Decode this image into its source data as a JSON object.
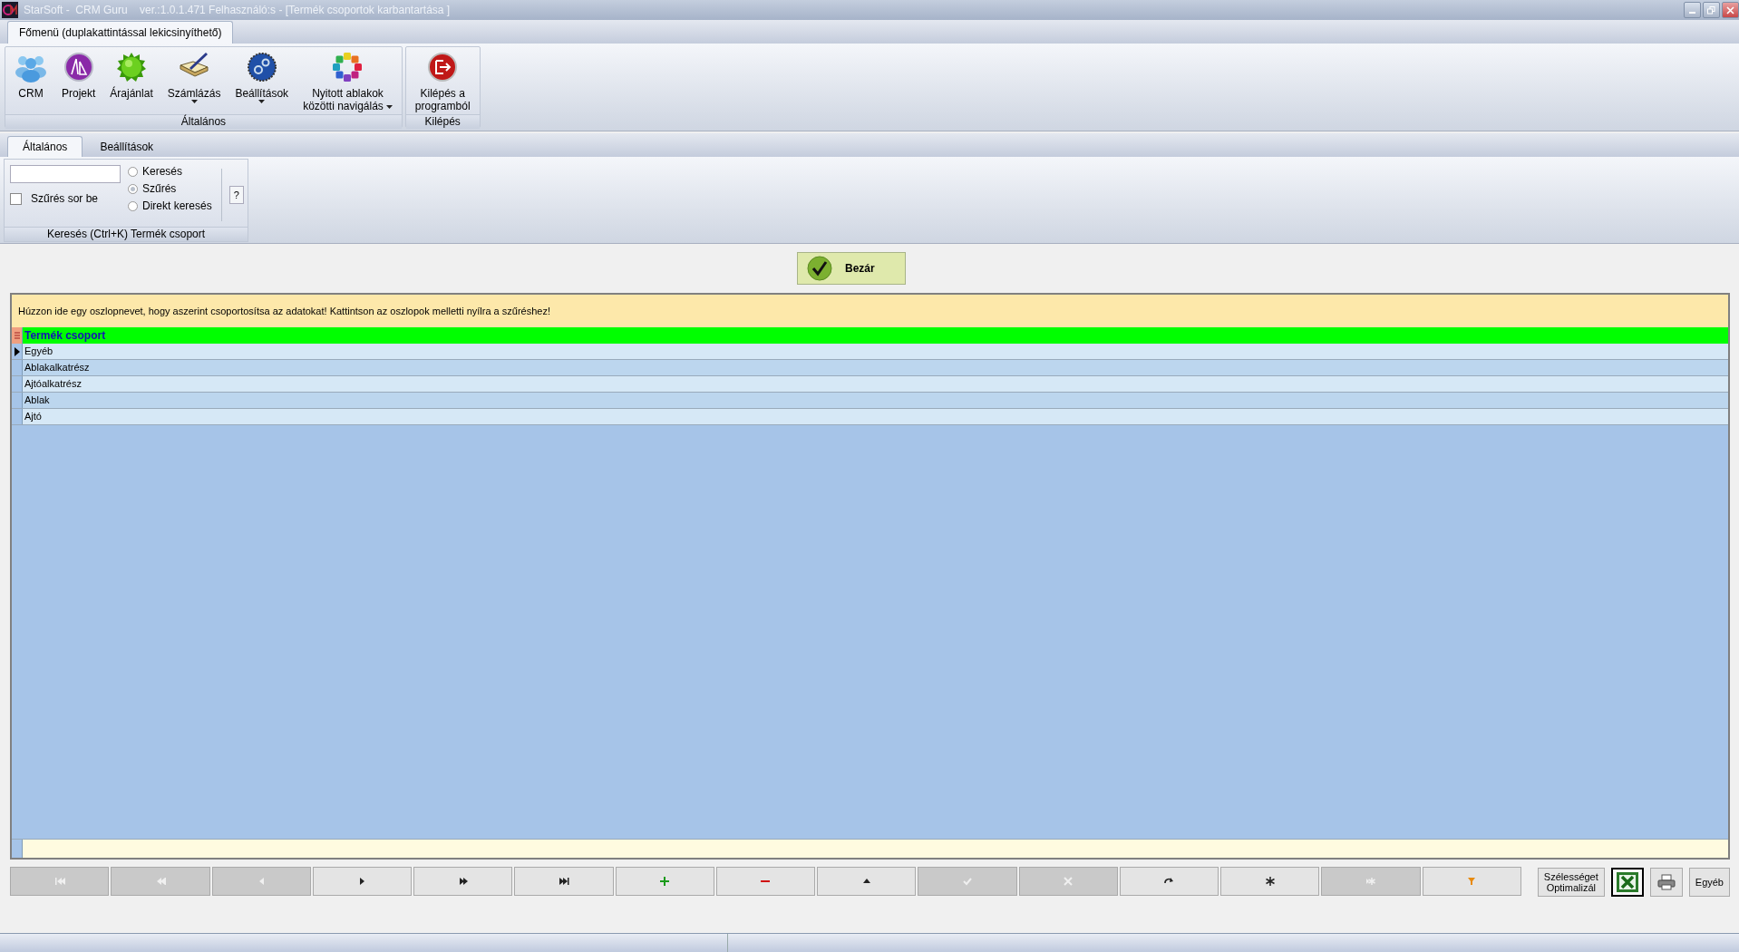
{
  "window": {
    "title": "StarSoft -  CRM Guru    ver.:1.0.1.471 Felhasználó:s - [Termék csoportok karbantartása ]"
  },
  "ribbon": {
    "tabs": [
      {
        "label": "Főmenü (duplakattintással lekicsinyíthető)",
        "selected": true
      }
    ],
    "groups": [
      {
        "label": "Általános",
        "items": [
          {
            "kind": "people",
            "label": "CRM",
            "dropdown": false
          },
          {
            "kind": "compass",
            "label": "Projekt",
            "dropdown": false
          },
          {
            "kind": "starburst",
            "label": "Árajánlat",
            "dropdown": false
          },
          {
            "kind": "book",
            "label": "Számlázás",
            "dropdown": true
          },
          {
            "kind": "gears",
            "label": "Beállítások",
            "dropdown": true
          },
          {
            "kind": "ring",
            "label": "Nyitott ablakok\nközötti navigálás",
            "dropdown": true
          }
        ]
      },
      {
        "label": "Kilépés",
        "items": [
          {
            "kind": "exit",
            "label": "Kilépés a\nprogramból",
            "dropdown": false
          }
        ]
      }
    ]
  },
  "tabs": [
    {
      "label": "Általános",
      "selected": true
    },
    {
      "label": "Beállítások",
      "selected": false
    }
  ],
  "search": {
    "filter_row": {
      "label": "Szűrés sor be",
      "checked": false
    },
    "modes": [
      {
        "label": "Keresés",
        "selected": false
      },
      {
        "label": "Szűrés",
        "selected": true
      },
      {
        "label": "Direkt keresés",
        "selected": false
      }
    ],
    "help_button": "?",
    "group_label": "Keresés (Ctrl+K) Termék csoport"
  },
  "close_button": "Bezár",
  "grid": {
    "group_hint": "Húzzon ide egy oszlopnevet, hogy aszerint csoportosítsa az adatokat! Kattintson az oszlopok melletti nyílra a szűréshez!",
    "columns": [
      "Termék csoport"
    ],
    "rows": [
      {
        "cells": [
          "Egyéb"
        ],
        "selected": true
      },
      {
        "cells": [
          "Ablakalkatrész"
        ],
        "selected": false
      },
      {
        "cells": [
          "Ajtóalkatrész"
        ],
        "selected": false
      },
      {
        "cells": [
          "Ablak"
        ],
        "selected": false
      },
      {
        "cells": [
          "Ajtó"
        ],
        "selected": false
      }
    ]
  },
  "navigator": [
    {
      "kind": "first",
      "disabled": true
    },
    {
      "kind": "prev_page",
      "disabled": true
    },
    {
      "kind": "prev",
      "disabled": true
    },
    {
      "kind": "next",
      "disabled": false
    },
    {
      "kind": "next_page",
      "disabled": false
    },
    {
      "kind": "last",
      "disabled": false
    },
    {
      "kind": "add",
      "disabled": false
    },
    {
      "kind": "delete",
      "disabled": false
    },
    {
      "kind": "edit",
      "disabled": false
    },
    {
      "kind": "post",
      "disabled": true
    },
    {
      "kind": "cancel",
      "disabled": true
    },
    {
      "kind": "refresh",
      "disabled": false
    },
    {
      "kind": "insert",
      "disabled": false
    },
    {
      "kind": "append",
      "disabled": true
    },
    {
      "kind": "filter",
      "disabled": false
    }
  ],
  "actions": [
    {
      "kind": "text",
      "label": "Szélességet\nOptimalizál"
    },
    {
      "kind": "excel"
    },
    {
      "kind": "print"
    },
    {
      "kind": "text",
      "label": "Egyéb"
    }
  ]
}
